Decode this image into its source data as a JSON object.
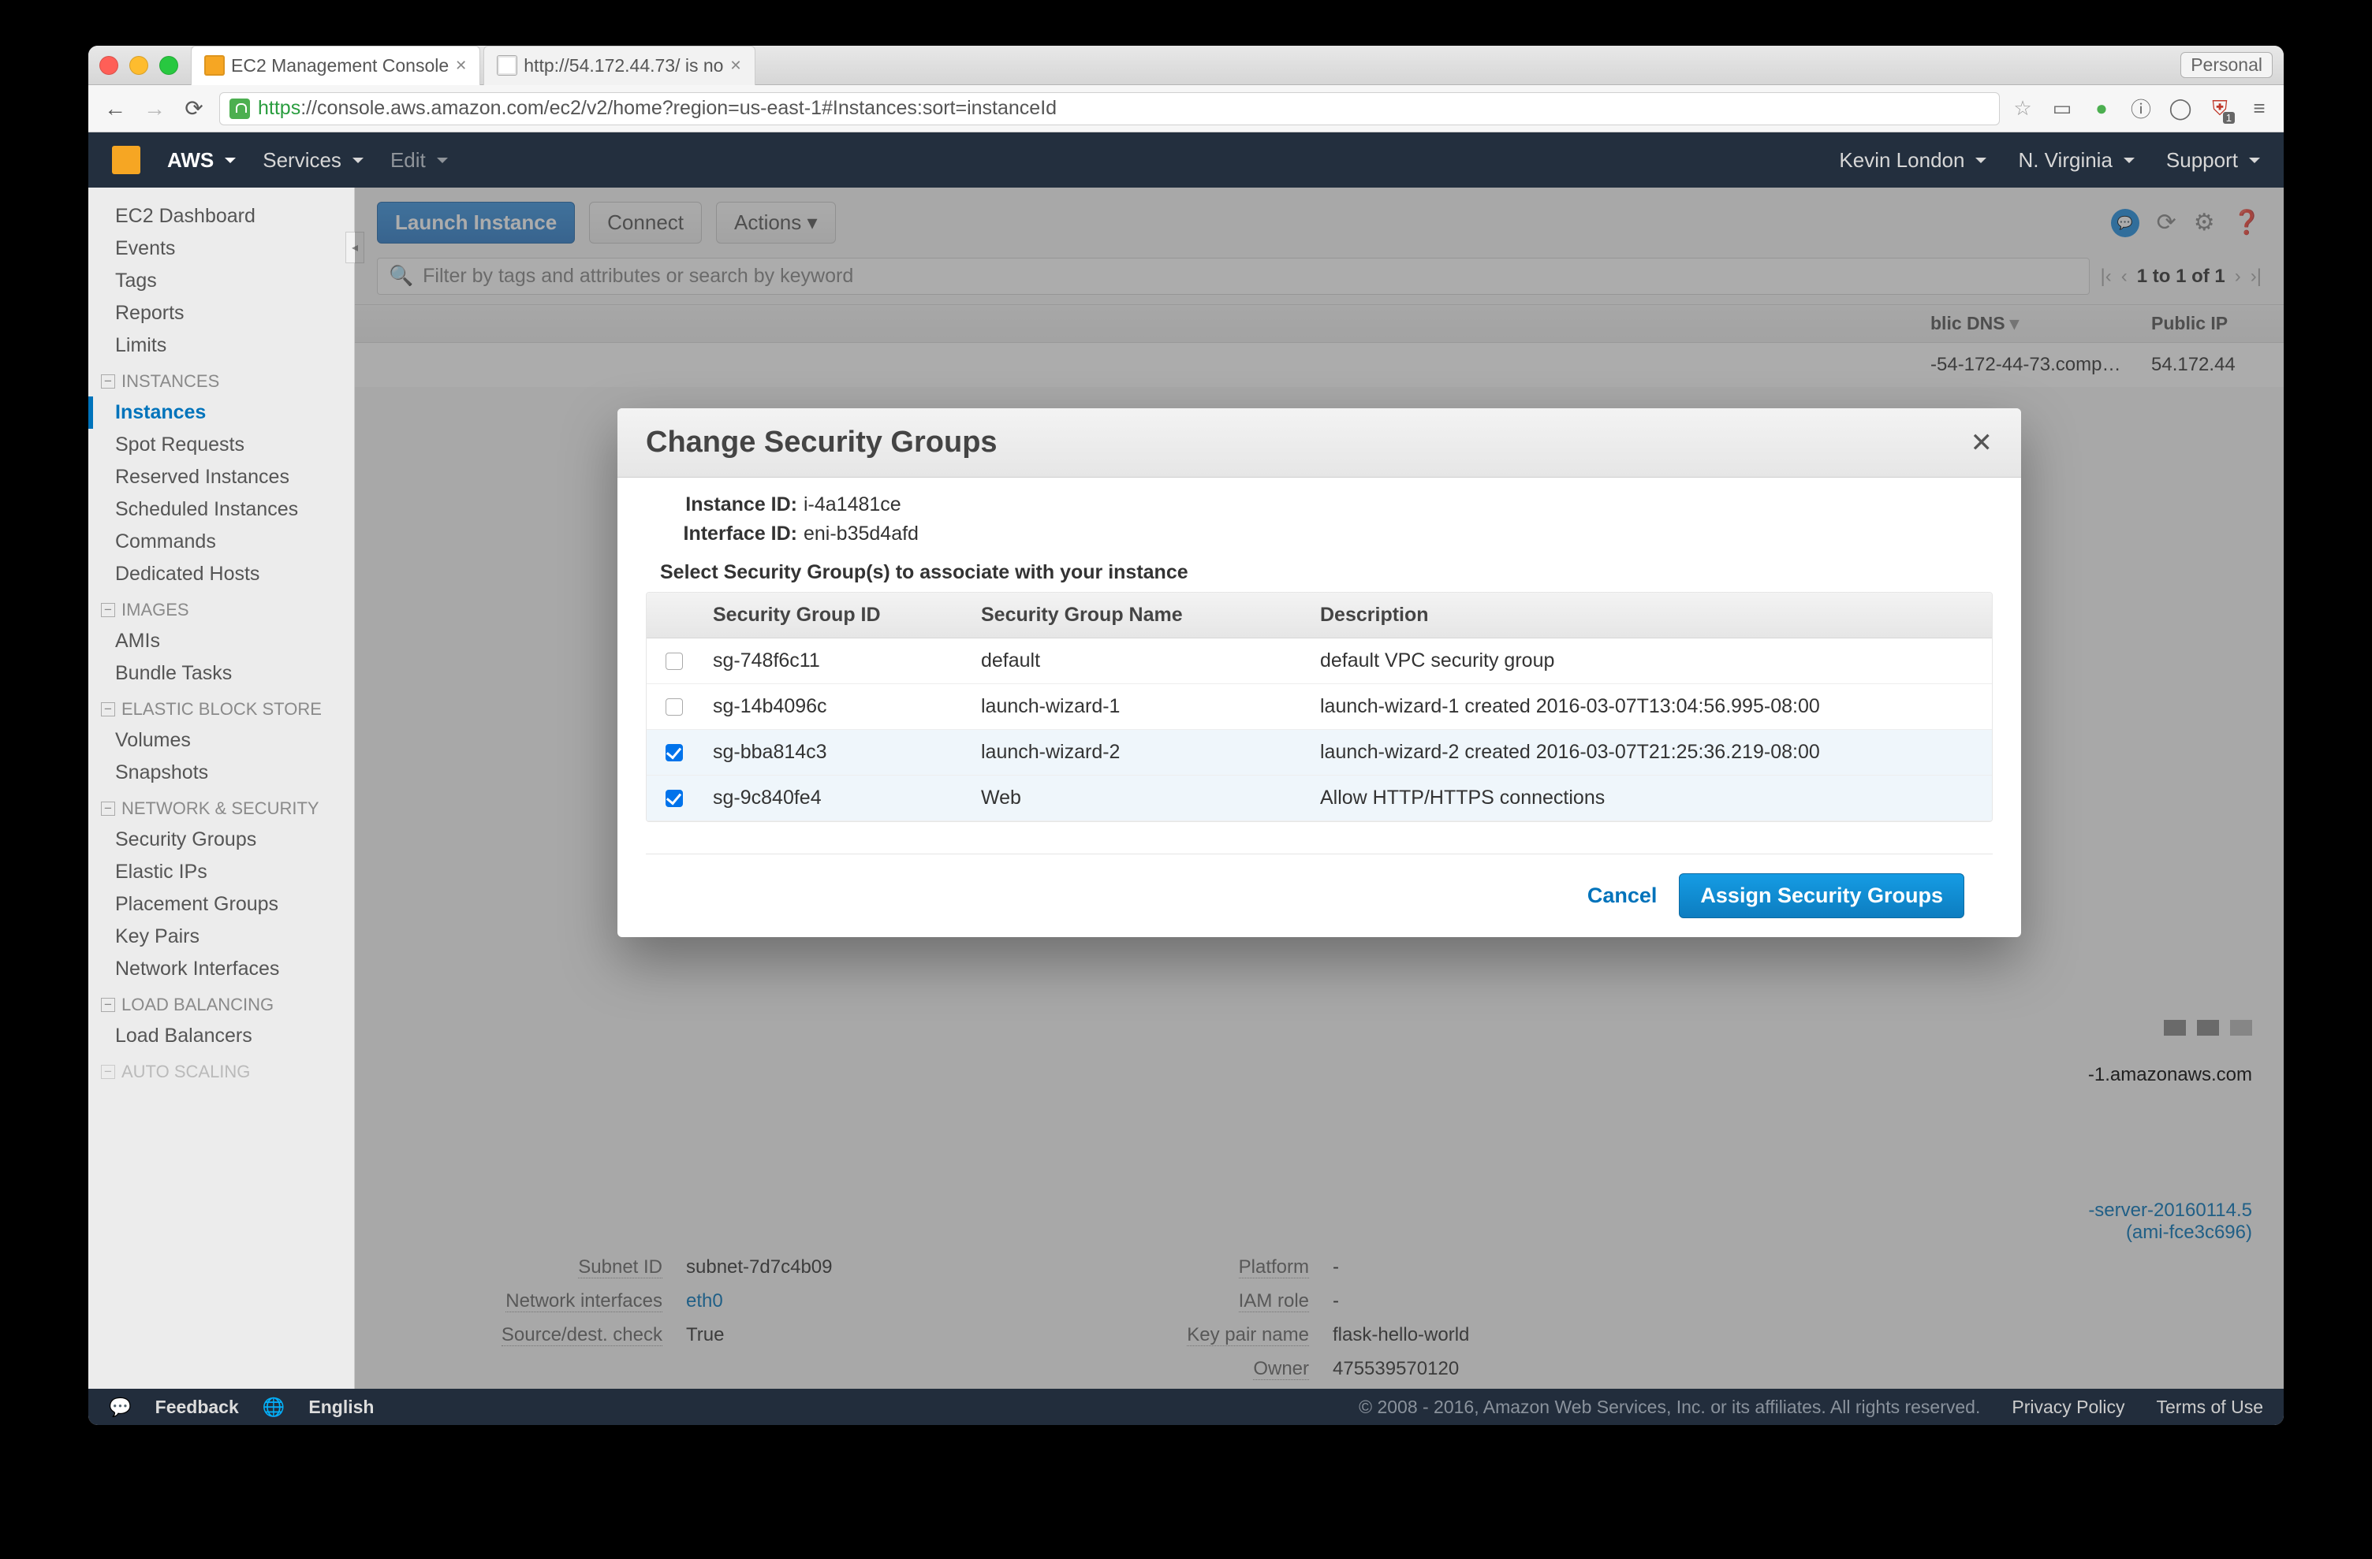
{
  "browser": {
    "tabs": [
      {
        "title": "EC2 Management Console",
        "active": true
      },
      {
        "title": "http://54.172.44.73/ is no",
        "active": false
      }
    ],
    "personal": "Personal",
    "url_https": "https",
    "url_rest": "://console.aws.amazon.com/ec2/v2/home?region=us-east-1#Instances:sort=instanceId"
  },
  "aws_header": {
    "aws": "AWS",
    "services": "Services",
    "edit": "Edit",
    "user": "Kevin London",
    "region": "N. Virginia",
    "support": "Support"
  },
  "sidebar": {
    "top": [
      "EC2 Dashboard",
      "Events",
      "Tags",
      "Reports",
      "Limits"
    ],
    "instances_label": "INSTANCES",
    "instances": [
      "Instances",
      "Spot Requests",
      "Reserved Instances",
      "Scheduled Instances",
      "Commands",
      "Dedicated Hosts"
    ],
    "images_label": "IMAGES",
    "images": [
      "AMIs",
      "Bundle Tasks"
    ],
    "ebs_label": "ELASTIC BLOCK STORE",
    "ebs": [
      "Volumes",
      "Snapshots"
    ],
    "net_label": "NETWORK & SECURITY",
    "net": [
      "Security Groups",
      "Elastic IPs",
      "Placement Groups",
      "Key Pairs",
      "Network Interfaces"
    ],
    "lb_label": "LOAD BALANCING",
    "lb": [
      "Load Balancers"
    ],
    "as_label": "AUTO SCALING"
  },
  "actions": {
    "launch": "Launch Instance",
    "connect": "Connect",
    "actions": "Actions"
  },
  "search_placeholder": "Filter by tags and attributes or search by keyword",
  "paging": "1 to 1 of 1",
  "table": {
    "th_dns": "blic DNS",
    "th_ip": "Public IP",
    "dns": "-54-172-44-73.comp…",
    "ip": "54.172.44"
  },
  "detail": {
    "dns_val": "-1.amazonaws.com",
    "ami_line": "-server-20160114.5",
    "ami_id": "(ami-fce3c696)",
    "subnet_l": "Subnet ID",
    "subnet_v": "subnet-7d7c4b09",
    "neti_l": "Network interfaces",
    "neti_v": "eth0",
    "src_l": "Source/dest. check",
    "src_v": "True",
    "plat_l": "Platform",
    "plat_v": "-",
    "iam_l": "IAM role",
    "iam_v": "-",
    "keyp_l": "Key pair name",
    "keyp_v": "flask-hello-world",
    "owner_l": "Owner",
    "owner_v": "475539570120"
  },
  "modal": {
    "title": "Change Security Groups",
    "inst_label": "Instance ID:",
    "inst_val": "i-4a1481ce",
    "iface_label": "Interface ID:",
    "iface_val": "eni-b35d4afd",
    "instruct": "Select Security Group(s) to associate with your instance",
    "col_id": "Security Group ID",
    "col_name": "Security Group Name",
    "col_desc": "Description",
    "rows": [
      {
        "checked": false,
        "id": "sg-748f6c11",
        "name": "default",
        "desc": "default VPC security group"
      },
      {
        "checked": false,
        "id": "sg-14b4096c",
        "name": "launch-wizard-1",
        "desc": "launch-wizard-1 created 2016-03-07T13:04:56.995-08:00"
      },
      {
        "checked": true,
        "id": "sg-bba814c3",
        "name": "launch-wizard-2",
        "desc": "launch-wizard-2 created 2016-03-07T21:25:36.219-08:00"
      },
      {
        "checked": true,
        "id": "sg-9c840fe4",
        "name": "Web",
        "desc": "Allow HTTP/HTTPS connections"
      }
    ],
    "cancel": "Cancel",
    "assign": "Assign Security Groups"
  },
  "footer": {
    "feedback": "Feedback",
    "english": "English",
    "copy": "© 2008 - 2016, Amazon Web Services, Inc. or its affiliates. All rights reserved.",
    "privacy": "Privacy Policy",
    "terms": "Terms of Use"
  }
}
